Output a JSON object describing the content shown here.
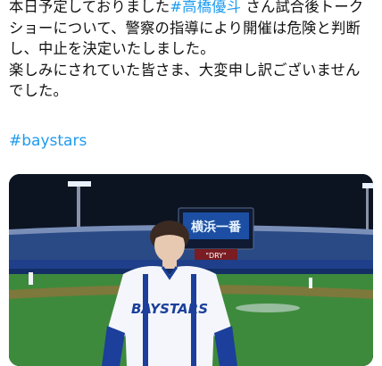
{
  "tweet": {
    "lines": [
      {
        "pre": "本日予定しておりました",
        "mention": "#高橋優斗",
        "post": " さん試合後トーク"
      },
      {
        "pre": "ショーについて、警察の指導により開催は危険と判断",
        "mention": "",
        "post": ""
      },
      {
        "pre": "し、中止を決定いたしました。",
        "mention": "",
        "post": ""
      },
      {
        "pre": "楽しみにされていた皆さま、大変申し訳ございません",
        "mention": "",
        "post": ""
      },
      {
        "pre": "でした。",
        "mention": "",
        "post": ""
      }
    ],
    "hashtag": "#baystars"
  },
  "media": {
    "scoreboard_text": "横浜一番",
    "banner_text": "\"DRY\"",
    "jersey_text": "BAYSTARS",
    "colors": {
      "sky": "#0c1422",
      "stands": "#2a4a86",
      "field": "#3e8a3c",
      "jersey_blue": "#1b3f9a"
    }
  }
}
